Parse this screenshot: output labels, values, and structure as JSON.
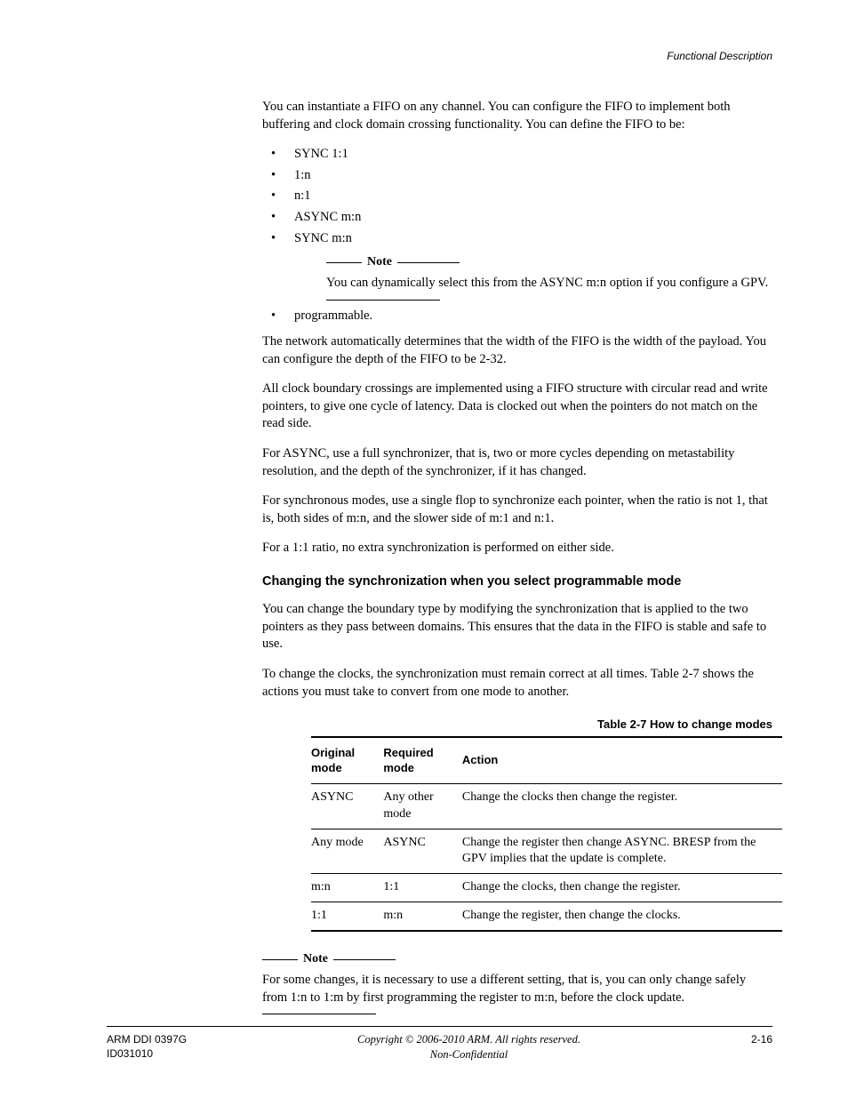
{
  "running_header": "Functional Description",
  "intro_para": "You can instantiate a FIFO on any channel. You can configure the FIFO to implement both buffering and clock domain crossing functionality. You can define the FIFO to be:",
  "bullets": [
    "SYNC 1:1",
    "1:n",
    "n:1",
    "ASYNC m:n",
    "SYNC m:n"
  ],
  "note_word": "Note",
  "note1_text": "You can dynamically select this from the ASYNC m:n option if you configure a GPV.",
  "bullet_last": "programmable.",
  "para2": "The network automatically determines that the width of the FIFO is the width of the payload. You can configure the depth of the FIFO to be 2-32.",
  "para3": "All clock boundary crossings are implemented using a FIFO structure with circular read and write pointers, to give one cycle of latency. Data is clocked out when the pointers do not match on the read side.",
  "para4": "For ASYNC, use a full synchronizer, that is, two or more cycles depending on metastability resolution, and the depth of the synchronizer, if it has changed.",
  "para5": "For synchronous modes, use a single flop to synchronize each pointer, when the ratio is not 1, that is, both sides of m:n, and the slower side of m:1 and n:1.",
  "para6": "For a 1:1 ratio, no extra synchronization is performed on either side.",
  "subhead": "Changing the synchronization when you select programmable mode",
  "para7": "You can change the boundary type by modifying the synchronization that is applied to the two pointers as they pass between domains. This ensures that the data in the FIFO is stable and safe to use.",
  "para8": "To change the clocks, the synchronization must remain correct at all times. Table 2-7 shows the actions you must take to convert from one mode to another.",
  "table_caption": "Table 2-7 How to change modes",
  "table": {
    "headers": [
      "Original mode",
      "Required mode",
      "Action"
    ],
    "rows": [
      [
        "ASYNC",
        "Any other mode",
        "Change the clocks then change the register."
      ],
      [
        "Any mode",
        "ASYNC",
        "Change the register then change ASYNC. BRESP from the GPV implies that the update is complete."
      ],
      [
        "m:n",
        "1:1",
        "Change the clocks, then change the register."
      ],
      [
        "1:1",
        "m:n",
        "Change the register, then change the clocks."
      ]
    ]
  },
  "note2_text": "For some changes, it is necessary to use a different setting, that is, you can only change safely from 1:n to 1:m by first programming the register to m:n, before the clock update.",
  "footer": {
    "left1": "ARM DDI 0397G",
    "left2": "ID031010",
    "center1": "Copyright © 2006-2010 ARM. All rights reserved.",
    "center2": "Non-Confidential",
    "right": "2-16"
  }
}
